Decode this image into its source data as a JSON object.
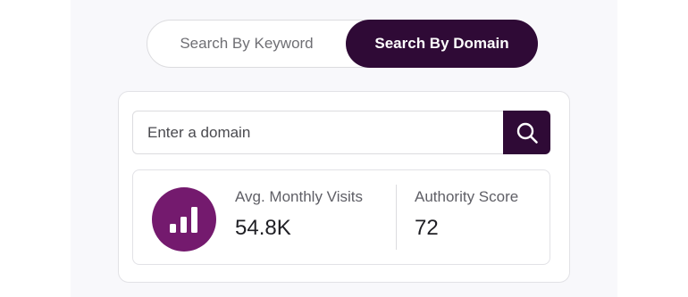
{
  "tabs": {
    "keyword_label": "Search By Keyword",
    "domain_label": "Search By Domain",
    "active": "domain"
  },
  "search": {
    "placeholder": "Enter a domain",
    "value": ""
  },
  "stats": {
    "visits_label": "Avg. Monthly Visits",
    "visits_value": "54.8K",
    "authority_label": "Authority Score",
    "authority_value": "72"
  },
  "colors": {
    "primary": "#2f0a36",
    "icon_bg": "#741a6e"
  },
  "icons": {
    "search": "search-icon",
    "stat": "bar-chart-icon"
  }
}
